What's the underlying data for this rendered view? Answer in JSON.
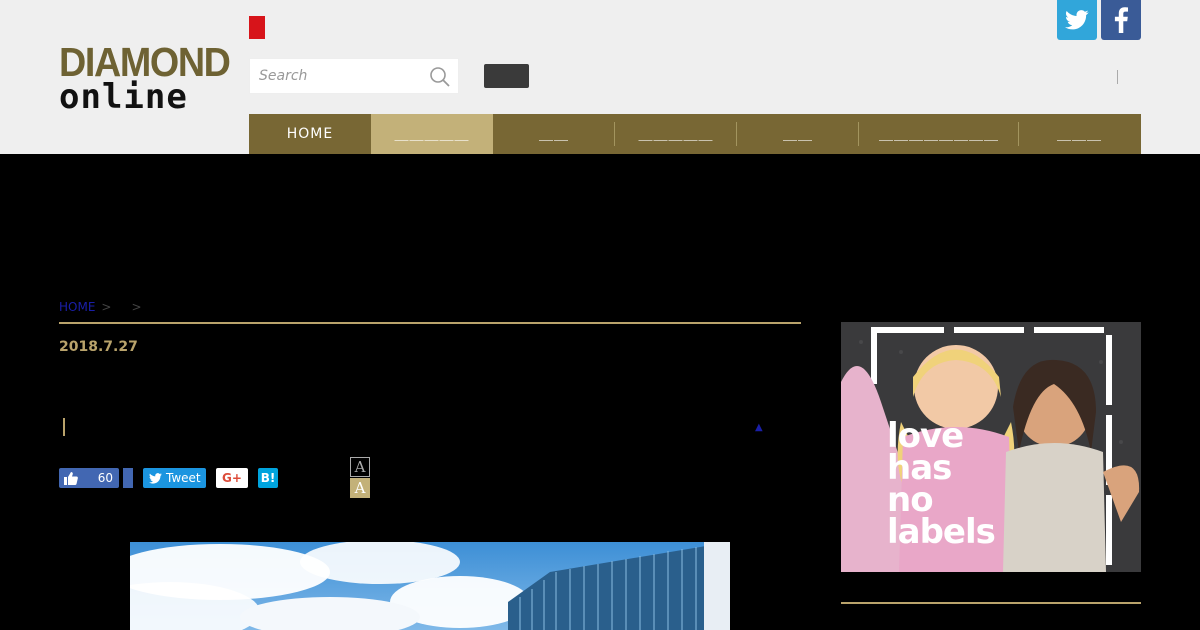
{
  "header": {
    "logo_line1": "DIAMOND",
    "logo_line2": "online",
    "search_placeholder": "Search"
  },
  "social": {
    "twitter_glyph": "t",
    "facebook_glyph": "f"
  },
  "nav": {
    "items": [
      "HOME",
      "＿＿＿＿＿",
      "＿＿",
      "＿＿＿＿＿",
      "＿＿",
      "＿＿＿＿＿＿＿＿",
      "＿＿＿"
    ]
  },
  "breadcrumb": {
    "home": "HOME",
    "sep": ">"
  },
  "article": {
    "date": "2018.7.27",
    "triangle": "▲"
  },
  "share": {
    "like_count": "60",
    "tweet": "Tweet",
    "gplus": "G+",
    "hatena": "B!"
  },
  "font_size": {
    "small": "A",
    "large": "A"
  },
  "ad": {
    "lines": [
      "love",
      "has",
      "no",
      "labels"
    ]
  },
  "colors": {
    "brand_gold": "#786734",
    "accent_gold": "#c3b179",
    "rule_gold": "#b9a36b",
    "twitter": "#31a6da",
    "facebook": "#3a5b97"
  }
}
